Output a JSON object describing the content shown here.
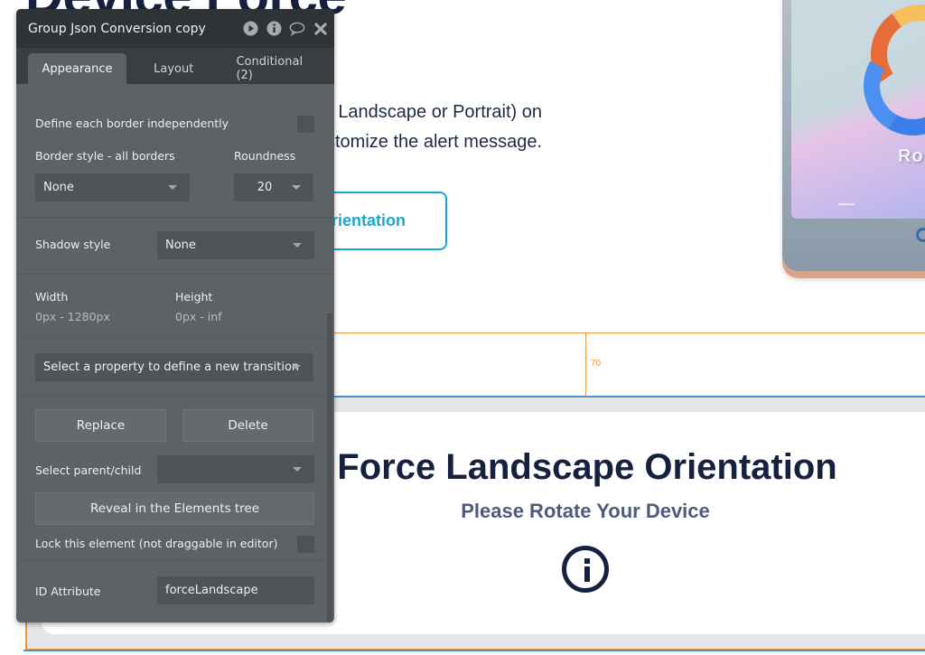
{
  "canvas": {
    "hero_title": "Device Force",
    "hero_desc_line1": "Landscape or Portrait) on",
    "hero_desc_line2": "customize the alert message.",
    "hero_button": "Force Orientation",
    "tablet_text": "Ro",
    "guide_value": "70",
    "alert_title": "Force Landscape Orientation",
    "alert_subtitle": "Please Rotate Your Device",
    "alert_icon": "info-circle-icon",
    "colors": {
      "navy": "#15213f",
      "accent_cyan": "#1ba7cf",
      "guide_orange": "#f29540",
      "guide_blue": "#4a90d9"
    }
  },
  "panel": {
    "title": "Group Json Conversion copy",
    "header_icons": [
      "play-icon",
      "info-icon",
      "comment-icon",
      "close-icon"
    ],
    "tabs": [
      {
        "label": "Appearance",
        "active": true
      },
      {
        "label": "Layout",
        "active": false
      },
      {
        "label": "Conditional (2)",
        "active": false
      }
    ],
    "border": {
      "independent_label": "Define each border independently",
      "independent_checked": false,
      "style_label": "Border style - all borders",
      "style_value": "None",
      "roundness_label": "Roundness",
      "roundness_value": "20"
    },
    "shadow": {
      "label": "Shadow style",
      "value": "None"
    },
    "size": {
      "width_label": "Width",
      "width_value": "0px - 1280px",
      "height_label": "Height",
      "height_value": "0px - inf"
    },
    "transition": {
      "placeholder": "Select a property to define a new transition"
    },
    "actions": {
      "replace": "Replace",
      "delete": "Delete"
    },
    "parent_child": {
      "label": "Select parent/child",
      "value": ""
    },
    "reveal": "Reveal in the Elements tree",
    "lock": {
      "label": "Lock this element (not draggable in editor)",
      "checked": false
    },
    "id_attribute": {
      "label": "ID Attribute",
      "value": "forceLandscape"
    }
  }
}
